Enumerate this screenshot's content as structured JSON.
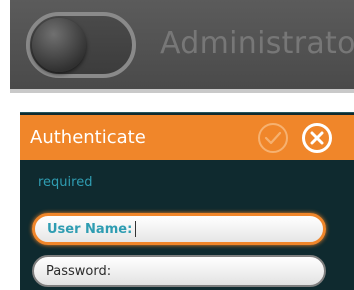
{
  "banner": {
    "toggle_state": "off",
    "label": "Administrator"
  },
  "dialog": {
    "title": "Authenticate",
    "confirm_icon": "check-icon",
    "close_icon": "close-icon",
    "required_text": "required",
    "fields": {
      "username": {
        "label": "User Name:",
        "value": ""
      },
      "password": {
        "label": "Password:",
        "value": ""
      }
    }
  },
  "colors": {
    "accent": "#f0862a",
    "dialog_background": "#0f2a2f",
    "required_text": "#2f9db2",
    "banner_background": "#555555"
  }
}
